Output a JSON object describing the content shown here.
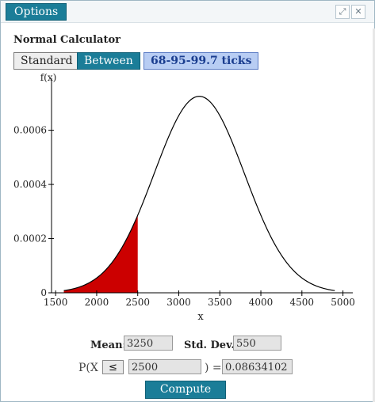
{
  "window": {
    "options_label": "Options",
    "expand_icon": "expand-icon",
    "close_icon": "close-icon"
  },
  "calculator": {
    "title": "Normal Calculator",
    "modes": [
      "Standard",
      "Between",
      "68-95-99.7 ticks"
    ],
    "active_mode": "Between"
  },
  "chart_data": {
    "type": "area",
    "ylabel": "f(x)",
    "xlabel": "x",
    "x_ticks": [
      1500,
      2000,
      2500,
      3000,
      3500,
      4000,
      4500,
      5000
    ],
    "y_ticks": [
      0,
      0.0002,
      0.0004,
      0.0006
    ],
    "y_tick_labels": [
      "0",
      "0.0002",
      "0.0004",
      "0.0006"
    ],
    "xlim": [
      1450,
      5120
    ],
    "ylim": [
      0,
      0.00078
    ],
    "curve": {
      "mean": 3250,
      "sd": 550,
      "x_from": 1600,
      "x_to": 4900,
      "color": "#000000"
    },
    "shaded_region": {
      "x_from": 1600,
      "x_to": 2500,
      "color": "#cc0000"
    }
  },
  "params": {
    "mean_label": "Mean:",
    "mean_value": "3250",
    "sd_label": "Std. Dev.:",
    "sd_value": "550",
    "p_prefix": "P(X",
    "operator": "≤",
    "x_value": "2500",
    "p_suffix": ") =",
    "result": "0.08634102",
    "compute_label": "Compute"
  },
  "colors": {
    "accent": "#1b7d98",
    "shade": "#cc0000",
    "tick_button": "#b8cdf3"
  }
}
